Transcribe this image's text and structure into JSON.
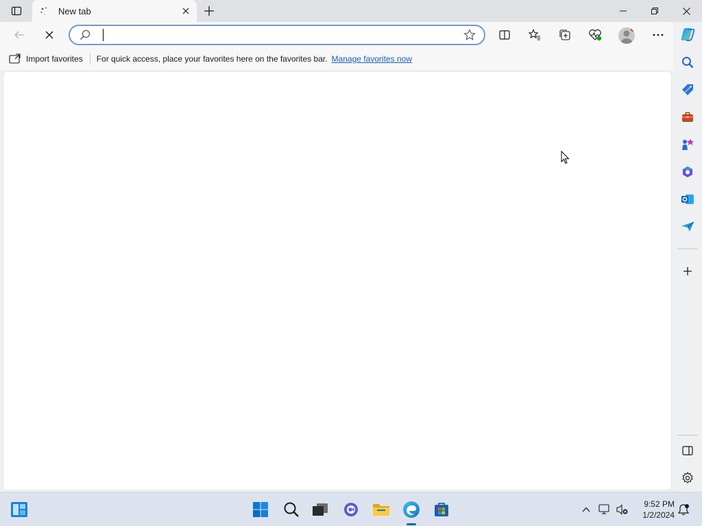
{
  "tab": {
    "title": "New tab",
    "close_icon": "close-icon",
    "loading_icon": "loading-spinner-icon"
  },
  "tabstrip": {
    "actions_icon": "tab-actions-icon",
    "new_tab_icon": "plus-icon"
  },
  "window": {
    "minimize_icon": "minimize-icon",
    "restore_icon": "restore-icon",
    "close_icon": "close-icon"
  },
  "toolbar": {
    "back_icon": "back-arrow-icon",
    "stop_icon": "stop-x-icon",
    "address": {
      "value": "",
      "placeholder": ""
    },
    "buttons": [
      "split-screen-icon",
      "favorites-icon",
      "collections-icon",
      "browser-essentials-icon",
      "profile-avatar",
      "more-icon",
      "copilot-icon"
    ]
  },
  "favbar": {
    "import_label": "Import favorites",
    "hint": "For quick access, place your favorites here on the favorites bar.",
    "manage_link": "Manage favorites now"
  },
  "sidebar": {
    "items": [
      "search-icon",
      "shopping-tag-icon",
      "tools-briefcase-icon",
      "games-icon",
      "microsoft-365-icon",
      "outlook-icon",
      "drop-send-icon",
      "add-icon",
      "hide-sidebar-icon",
      "settings-icon"
    ]
  },
  "taskbar": {
    "apps": [
      "widgets-icon",
      "start-icon",
      "search-icon",
      "task-view-icon",
      "chat-icon",
      "file-explorer-icon",
      "edge-icon",
      "store-icon"
    ],
    "time": "9:52 PM",
    "date": "1/2/2024"
  },
  "colors": {
    "accent": "#0067c0",
    "link": "#1a5fb4",
    "address_border": "#6a9ad8"
  }
}
